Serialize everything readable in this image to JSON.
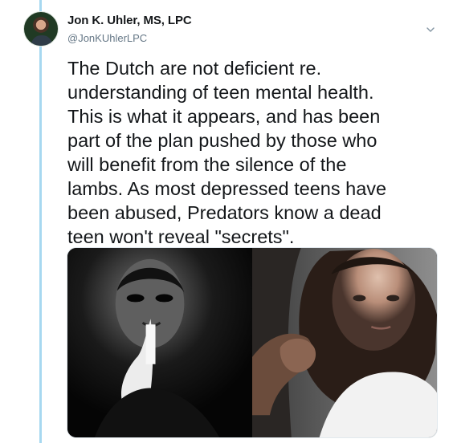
{
  "tweet": {
    "author": {
      "display_name": "Jon K. Uhler, MS, LPC",
      "handle": "@JonKUhlerLPC",
      "avatar_icon": "profile-photo"
    },
    "text": "The Dutch are not deficient re.\nunderstanding of teen mental health.\nThis is what it appears, and has been\npart of the plan pushed by those who\nwill benefit from the silence of the\nlambs. As most depressed teens have\nbeen abused, Predators know a dead\nteen won't reveal \"secrets\".",
    "menu_icon": "chevron-down-icon",
    "media": {
      "left_panel": "shadowed-man-finger-on-lips",
      "right_panel": "girl-with-hand-on-shoulder"
    }
  },
  "colors": {
    "thread_line": "#a7d8f0",
    "text_primary": "#14171a",
    "text_secondary": "#657786",
    "chevron": "#8899a6"
  }
}
